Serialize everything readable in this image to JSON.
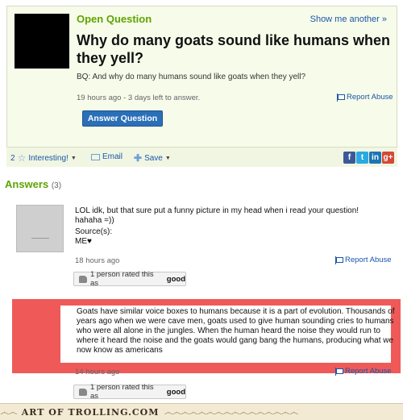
{
  "question": {
    "label": "Open Question",
    "show_another": "Show me another »",
    "title": "Why do many goats sound like humans when they yell?",
    "body": "BQ: And why do many humans sound like goats when they yell?",
    "meta": "19 hours ago - 3 days left to answer.",
    "report": "Report Abuse",
    "answer_button": "Answer Question"
  },
  "toolbar": {
    "count": "2",
    "interesting": "Interesting!",
    "email": "Email",
    "save": "Save",
    "social": [
      "f",
      "t",
      "in",
      "g+"
    ]
  },
  "answers_header": {
    "label": "Answers",
    "count": "(3)"
  },
  "answers": [
    {
      "text": "LOL idk, but that sure put a funny picture in my head when i read your question! hahaha =))",
      "source_label": "Source(s):",
      "source": "ME♥",
      "meta": "18 hours ago",
      "report": "Report Abuse",
      "rating": "1 person rated this as",
      "rating_value": "good"
    },
    {
      "text": "Goats have similar voice boxes to humans because it is a part of evolution. Thousands of years ago when we were cave men, goats used to give human sounding cries to humans who were all alone in the jungles. When the human heard the noise they would run to where it heard the noise and the goats would gang bang the humans, producing what we now know as americans",
      "meta": "14 hours ago",
      "report": "Report Abuse",
      "rating": "1 person rated this as",
      "rating_value": "good"
    }
  ],
  "footer": {
    "brand": "ART OF TROLLING.COM"
  },
  "colors": {
    "green": "#5ea400",
    "blue": "#1a56a8",
    "highlight": "#ef5a59"
  }
}
